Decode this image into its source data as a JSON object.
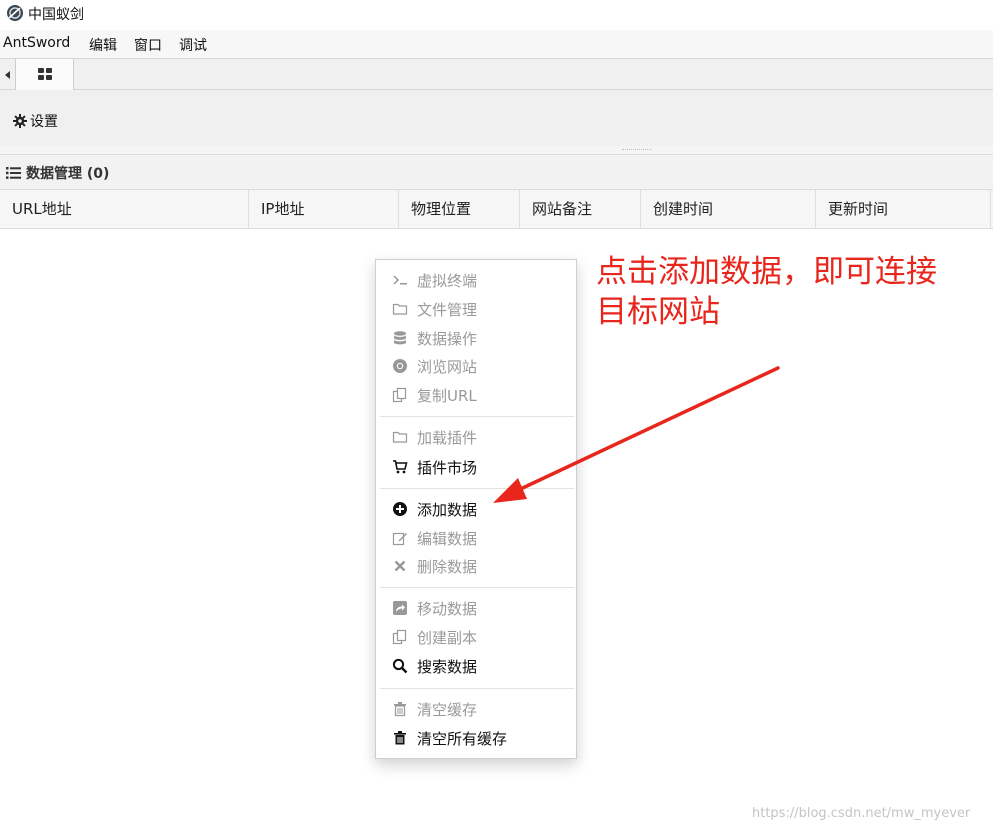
{
  "window": {
    "title": "中国蚁剑"
  },
  "menubar": {
    "items": [
      "AntSword",
      "编辑",
      "窗口",
      "调试"
    ]
  },
  "toolbar": {
    "settings_label": "设置"
  },
  "panel": {
    "title": "数据管理 (0)"
  },
  "grid": {
    "columns": [
      "URL地址",
      "IP地址",
      "物理位置",
      "网站备注",
      "创建时间",
      "更新时间"
    ]
  },
  "context_menu": {
    "items": [
      {
        "label": "虚拟终端",
        "icon": "terminal-icon",
        "enabled": false
      },
      {
        "label": "文件管理",
        "icon": "folder-icon",
        "enabled": false
      },
      {
        "label": "数据操作",
        "icon": "database-icon",
        "enabled": false
      },
      {
        "label": "浏览网站",
        "icon": "chrome-icon",
        "enabled": false
      },
      {
        "label": "复制URL",
        "icon": "copy-icon",
        "enabled": false
      },
      {
        "label": "加载插件",
        "icon": "folder-icon",
        "enabled": false
      },
      {
        "label": "插件市场",
        "icon": "cart-icon",
        "enabled": true
      },
      {
        "label": "添加数据",
        "icon": "plus-circle-icon",
        "enabled": true
      },
      {
        "label": "编辑数据",
        "icon": "edit-icon",
        "enabled": false
      },
      {
        "label": "删除数据",
        "icon": "close-icon",
        "enabled": false
      },
      {
        "label": "移动数据",
        "icon": "share-icon",
        "enabled": false
      },
      {
        "label": "创建副本",
        "icon": "copy-icon",
        "enabled": false
      },
      {
        "label": "搜索数据",
        "icon": "search-icon",
        "enabled": true
      },
      {
        "label": "清空缓存",
        "icon": "trash-icon",
        "enabled": false
      },
      {
        "label": "清空所有缓存",
        "icon": "trash-icon",
        "enabled": true
      }
    ]
  },
  "annotation": {
    "text": "点击添加数据，即可连接目标网站",
    "color": "#e8261c"
  },
  "watermark": {
    "text": "https://blog.csdn.net/mw_myever"
  }
}
